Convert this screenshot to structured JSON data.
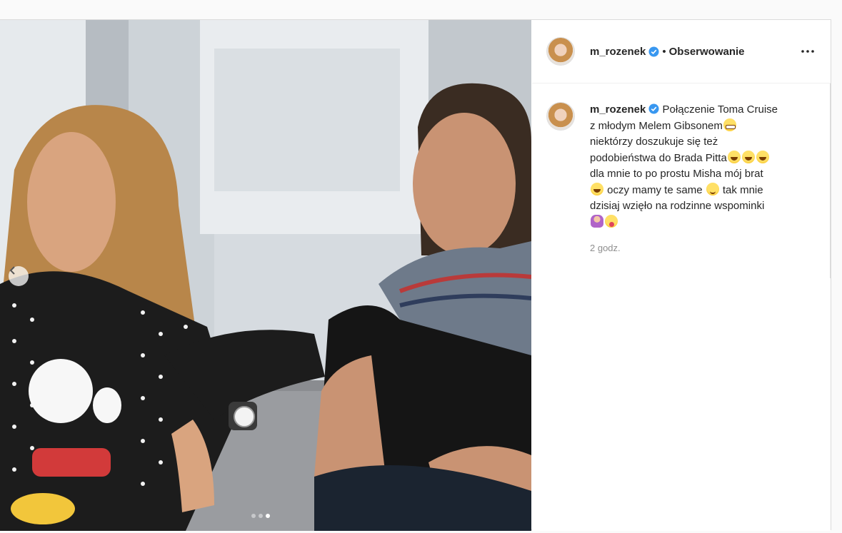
{
  "post": {
    "author": {
      "username": "m_rozenek",
      "verified": true,
      "follow_label": "Obserwowanie",
      "separator": "•"
    },
    "caption": {
      "username": "m_rozenek",
      "lines": [
        "Połączenie Toma Cruise",
        "z młodym Melem Gibsonem",
        "niektórzy doszukuje się też",
        "podobieństwa do Brada Pitta",
        "dla mnie to po prostu Misha mój brat",
        "oczy mamy te same",
        "tak mnie",
        "dzisiaj wzięło na rodzinne wspominki"
      ],
      "timestamp": "2 godz."
    },
    "carousel": {
      "total": 3,
      "active_index": 2
    }
  },
  "icons": {
    "verified": "verified-badge-icon",
    "more": "more-options-icon",
    "prev": "chevron-left-icon"
  },
  "colors": {
    "verified_blue": "#3897f0",
    "muted_text": "#8e8e8e",
    "text": "#262626",
    "border": "#dbdbdb"
  }
}
